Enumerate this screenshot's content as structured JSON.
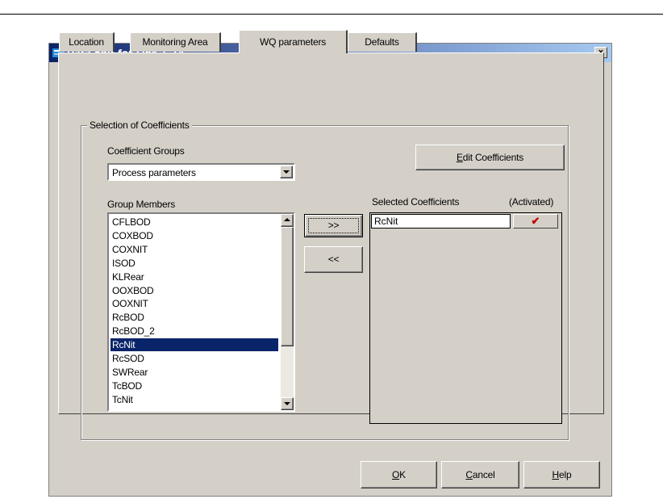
{
  "window": {
    "title": "Data Edit for Link 1_14",
    "close_glyph": "×"
  },
  "tabs": [
    {
      "label": "Location",
      "active": false
    },
    {
      "label": "Monitoring Area",
      "active": false
    },
    {
      "label": "WQ parameters",
      "active": true
    },
    {
      "label": "Defaults",
      "active": false
    }
  ],
  "group": {
    "legend": "Selection of Coefficients",
    "coefficient_groups_label": "Coefficient Groups",
    "coefficient_groups_value": "Process parameters",
    "edit_button": {
      "mnemonic": "E",
      "rest": "dit Coefficients"
    },
    "group_members_label": "Group Members",
    "group_members": [
      "CFLBOD",
      "COXBOD",
      "COXNIT",
      "ISOD",
      "KLRear",
      "OOXBOD",
      "OOXNIT",
      "RcBOD",
      "RcBOD_2",
      "RcNit",
      "RcSOD",
      "SWRear",
      "TcBOD",
      "TcNit"
    ],
    "selected_member": "RcNit",
    "add_button": ">>",
    "remove_button": "<<",
    "selected_label": "Selected Coefficients",
    "activated_label": "(Activated)",
    "selected": [
      {
        "name": "RcNit",
        "activated": true,
        "mark": "✔"
      }
    ]
  },
  "footer": {
    "ok": {
      "mnemonic": "O",
      "rest": "K"
    },
    "cancel": {
      "mnemonic": "C",
      "rest": "ancel"
    },
    "help": {
      "mnemonic": "H",
      "rest": "elp"
    }
  }
}
